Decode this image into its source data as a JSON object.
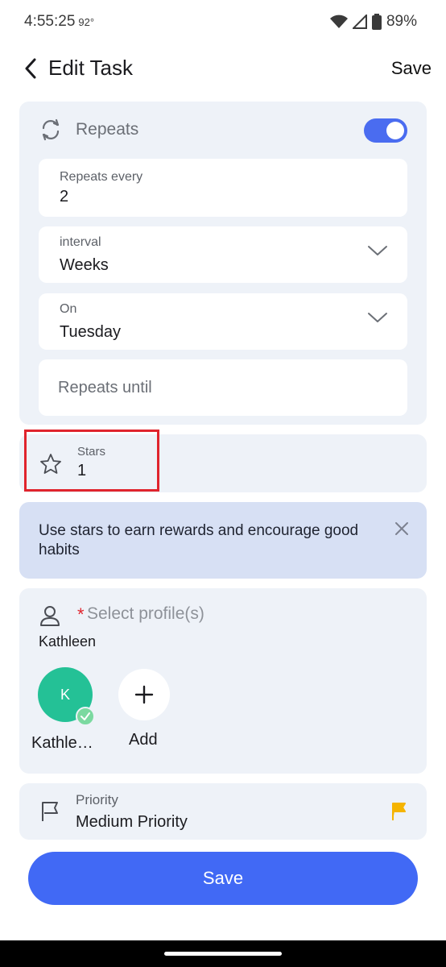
{
  "status_bar": {
    "time": "4:55:25",
    "temperature": "92°",
    "battery": "89%"
  },
  "header": {
    "title": "Edit Task",
    "save_label": "Save"
  },
  "repeat": {
    "label": "Repeats",
    "enabled": true,
    "every": {
      "label": "Repeats every",
      "value": "2"
    },
    "interval": {
      "label": "interval",
      "value": "Weeks"
    },
    "on": {
      "label": "On",
      "value": "Tuesday"
    },
    "until": {
      "placeholder": "Repeats until"
    }
  },
  "stars": {
    "label": "Stars",
    "value": "1"
  },
  "info_banner": {
    "text": "Use stars to earn rewards and encourage good habits"
  },
  "profiles": {
    "required_mark": "*",
    "placeholder": "Select profile(s)",
    "selected_text": "Kathleen",
    "avatar_initial": "K",
    "avatar_name": "Kathle…",
    "add_label": "Add",
    "avatar_color": "#24c196"
  },
  "priority": {
    "label": "Priority",
    "value": "Medium Priority",
    "flag_color": "#f5b400"
  },
  "footer": {
    "save_label": "Save",
    "accent": "#4169f5"
  }
}
